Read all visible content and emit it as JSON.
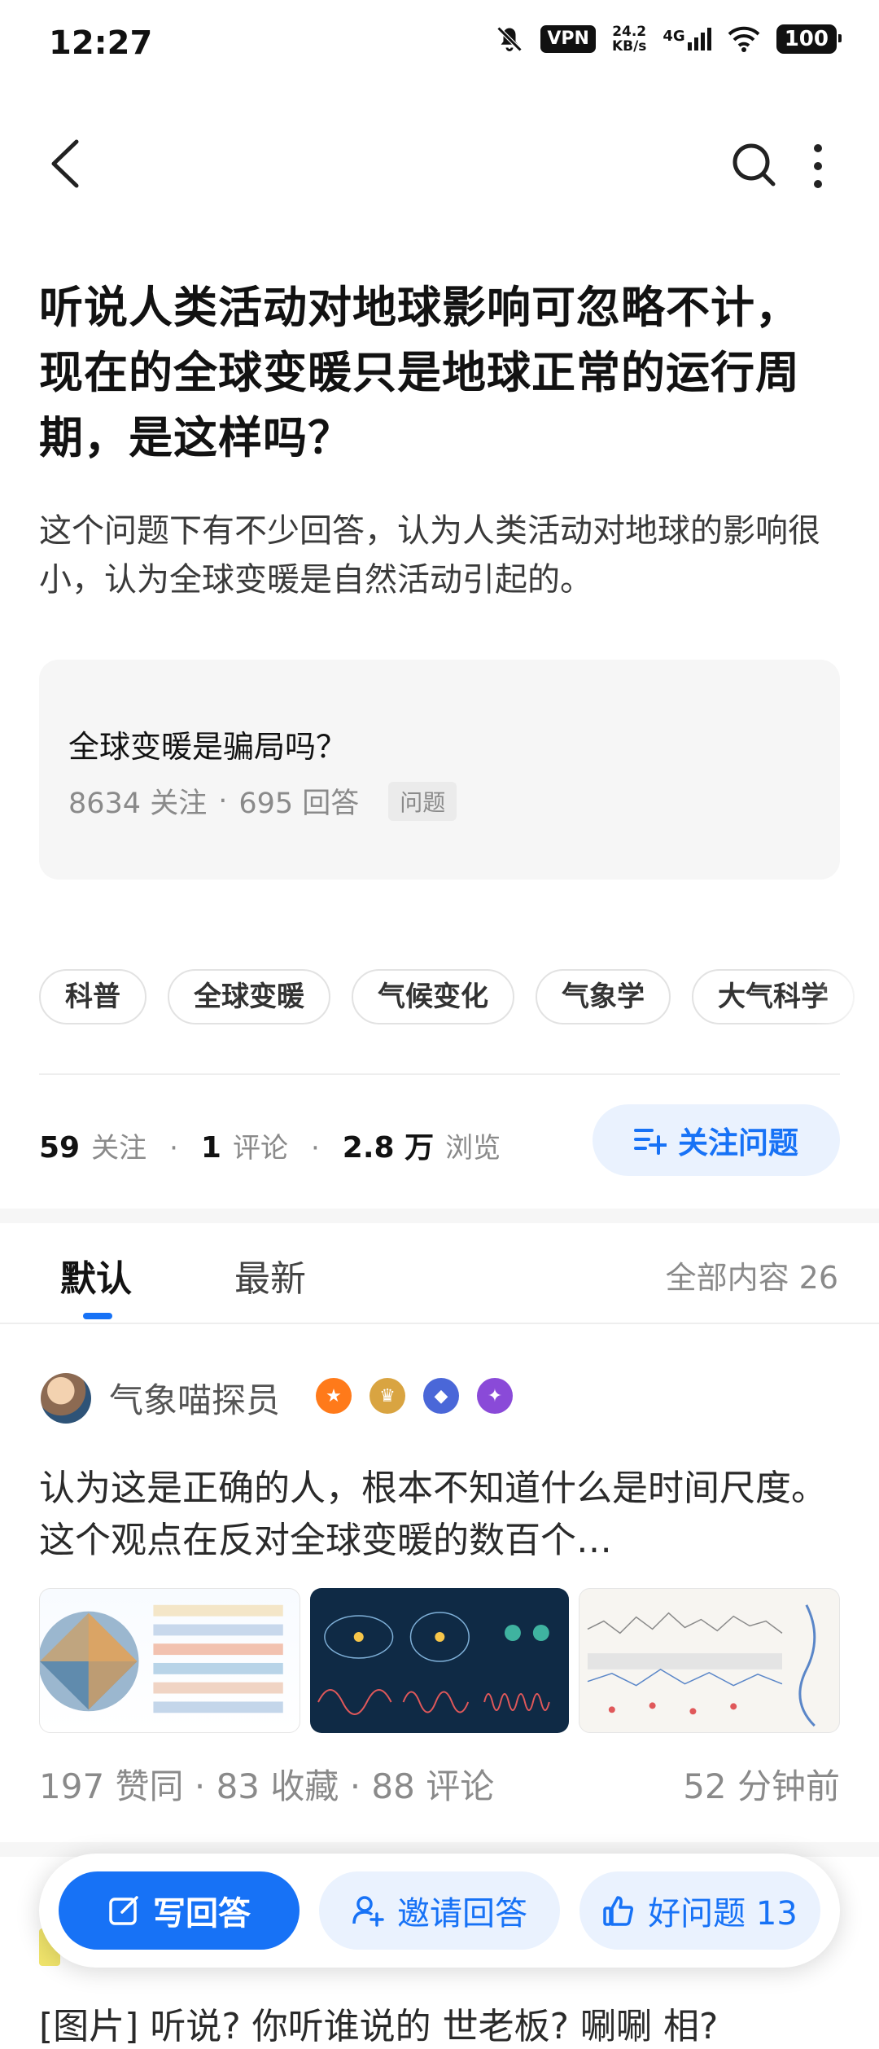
{
  "status_bar": {
    "time": "12:27",
    "vpn": "VPN",
    "net_speed_value": "24.2",
    "net_speed_unit": "KB/s",
    "network": "4G",
    "battery": "100"
  },
  "question": {
    "title": "听说人类活动对地球影响可忽略不计，现在的全球变暖只是地球正常的运行周期，是这样吗？",
    "description": "这个问题下有不少回答，认为人类活动对地球的影响很小，认为全球变暖是自然活动引起的。"
  },
  "related": {
    "title": "全球变暖是骗局吗？",
    "followers": "8634 关注",
    "sep": "·",
    "answers": "695 回答",
    "tag": "问题"
  },
  "topics": [
    "科普",
    "全球变暖",
    "气候变化",
    "气象学",
    "大气科学"
  ],
  "stats": {
    "follow_count": "59",
    "follow_label": "关注",
    "comment_count": "1",
    "comment_label": "评论",
    "view_count": "2.8 万",
    "view_label": "浏览",
    "sep": "·"
  },
  "follow_button": "关注问题",
  "tabs": {
    "default": "默认",
    "newest": "最新",
    "all_count": "全部内容 26"
  },
  "answer": {
    "author": "气象喵探员",
    "text": "认为这是正确的人，根本不知道什么是时间尺度。这个观点在反对全球变暖的数百个…",
    "meta": "197 赞同 · 83 收藏 · 88 评论",
    "time": "52 分钟前"
  },
  "bottom_bar": {
    "write": "写回答",
    "invite": "邀请回答",
    "good": "好问题 13"
  },
  "next_peek": "[图片] 听说? 你听谁说的 世老板? 唰唰 相?"
}
